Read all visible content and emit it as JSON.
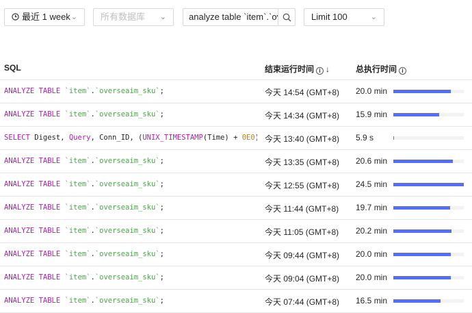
{
  "toolbar": {
    "time_range": "最近 1 week",
    "db_placeholder": "所有数据库",
    "search_value": "analyze table `item`.`overseaim_sku`",
    "limit": "Limit 100"
  },
  "columns": {
    "sql": "SQL",
    "end_time": "结束运行时间",
    "total_time": "总执行时间"
  },
  "rows": [
    {
      "sql": "ANALYZE TABLE `item`.`overseaim_sku`;",
      "end_time": "今天 14:54 (GMT+8)",
      "duration": "20.0 min",
      "ratio": 0.816
    },
    {
      "sql": "ANALYZE TABLE `item`.`overseaim_sku`;",
      "end_time": "今天 14:34 (GMT+8)",
      "duration": "15.9 min",
      "ratio": 0.649
    },
    {
      "sql": "SELECT Digest, Query, Conn_ID, (UNIX_TIMESTAMP(Time) + 0E0)…",
      "end_time": "今天 13:40 (GMT+8)",
      "duration": "5.9 s",
      "ratio": 0.004
    },
    {
      "sql": "ANALYZE TABLE `item`.`overseaim_sku`;",
      "end_time": "今天 13:35 (GMT+8)",
      "duration": "20.6 min",
      "ratio": 0.841
    },
    {
      "sql": "ANALYZE TABLE `item`.`overseaim_sku`;",
      "end_time": "今天 12:55 (GMT+8)",
      "duration": "24.5 min",
      "ratio": 1.0
    },
    {
      "sql": "ANALYZE TABLE `item`.`overseaim_sku`;",
      "end_time": "今天 11:44 (GMT+8)",
      "duration": "19.7 min",
      "ratio": 0.804
    },
    {
      "sql": "ANALYZE TABLE `item`.`overseaim_sku`;",
      "end_time": "今天 11:05 (GMT+8)",
      "duration": "20.2 min",
      "ratio": 0.824
    },
    {
      "sql": "ANALYZE TABLE `item`.`overseaim_sku`;",
      "end_time": "今天 09:44 (GMT+8)",
      "duration": "20.0 min",
      "ratio": 0.816
    },
    {
      "sql": "ANALYZE TABLE `item`.`overseaim_sku`;",
      "end_time": "今天 09:04 (GMT+8)",
      "duration": "20.0 min",
      "ratio": 0.816
    },
    {
      "sql": "ANALYZE TABLE `item`.`overseaim_sku`;",
      "end_time": "今天 07:44 (GMT+8)",
      "duration": "16.5 min",
      "ratio": 0.673
    }
  ],
  "colors": {
    "keyword": "#a626a4",
    "string": "#50a14f",
    "number": "#c18401",
    "bar_fill": "#536dfe",
    "bar_track": "#f2f2f2"
  }
}
